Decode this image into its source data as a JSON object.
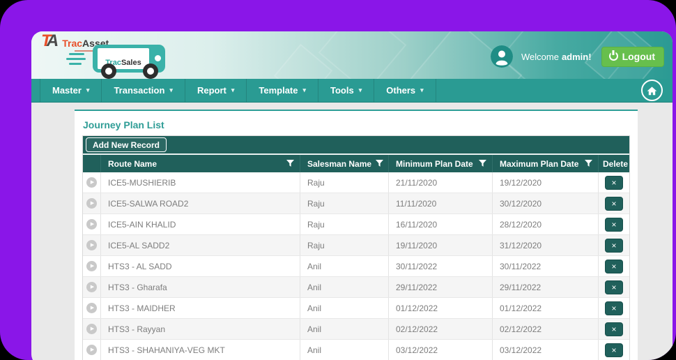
{
  "brand": {
    "monogram_t": "T",
    "monogram_a": "A",
    "name_orange": "Trac",
    "name_dark": "Asset",
    "product_teal": "Trac",
    "product_dark": "Sales"
  },
  "user": {
    "welcome_prefix": "Welcome",
    "username": "admin!",
    "logout_label": "Logout"
  },
  "nav": {
    "caret": "▾",
    "items": [
      {
        "label": "Master"
      },
      {
        "label": "Transaction"
      },
      {
        "label": "Report"
      },
      {
        "label": "Template"
      },
      {
        "label": "Tools"
      },
      {
        "label": "Others"
      }
    ]
  },
  "page": {
    "title": "Journey Plan List",
    "add_button_label": "Add New Record"
  },
  "table": {
    "expander_glyph": "▶",
    "delete_glyph": "×",
    "columns": [
      {
        "label": "",
        "filter": false
      },
      {
        "label": "Route Name",
        "filter": true
      },
      {
        "label": "Salesman Name",
        "filter": true
      },
      {
        "label": "Minimum Plan Date",
        "filter": true
      },
      {
        "label": "Maximum Plan Date",
        "filter": true
      },
      {
        "label": "Delete",
        "filter": false
      }
    ],
    "rows": [
      {
        "route": "ICE5-MUSHIERIB",
        "salesman": "Raju",
        "min_date": "21/11/2020",
        "max_date": "19/12/2020"
      },
      {
        "route": "ICE5-SALWA ROAD2",
        "salesman": "Raju",
        "min_date": "11/11/2020",
        "max_date": "30/12/2020"
      },
      {
        "route": "ICE5-AIN KHALID",
        "salesman": "Raju",
        "min_date": "16/11/2020",
        "max_date": "28/12/2020"
      },
      {
        "route": "ICE5-AL SADD2",
        "salesman": "Raju",
        "min_date": "19/11/2020",
        "max_date": "31/12/2020"
      },
      {
        "route": "HTS3 - AL SADD",
        "salesman": "Anil",
        "min_date": "30/11/2022",
        "max_date": "30/11/2022"
      },
      {
        "route": "HTS3 - Gharafa",
        "salesman": "Anil",
        "min_date": "29/11/2022",
        "max_date": "29/11/2022"
      },
      {
        "route": "HTS3 - MAIDHER",
        "salesman": "Anil",
        "min_date": "01/12/2022",
        "max_date": "01/12/2022"
      },
      {
        "route": "HTS3 - Rayyan",
        "salesman": "Anil",
        "min_date": "02/12/2022",
        "max_date": "02/12/2022"
      },
      {
        "route": "HTS3 - SHAHANIYA-VEG MKT",
        "salesman": "Anil",
        "min_date": "03/12/2022",
        "max_date": "03/12/2022"
      }
    ]
  },
  "colors": {
    "frame_purple": "#8a16e8",
    "teal_accent": "#2a9b93",
    "dark_teal": "#20605b",
    "logout_green": "#67bf4d",
    "brand_orange": "#e8502a",
    "page_gray": "#e9e9e9"
  }
}
